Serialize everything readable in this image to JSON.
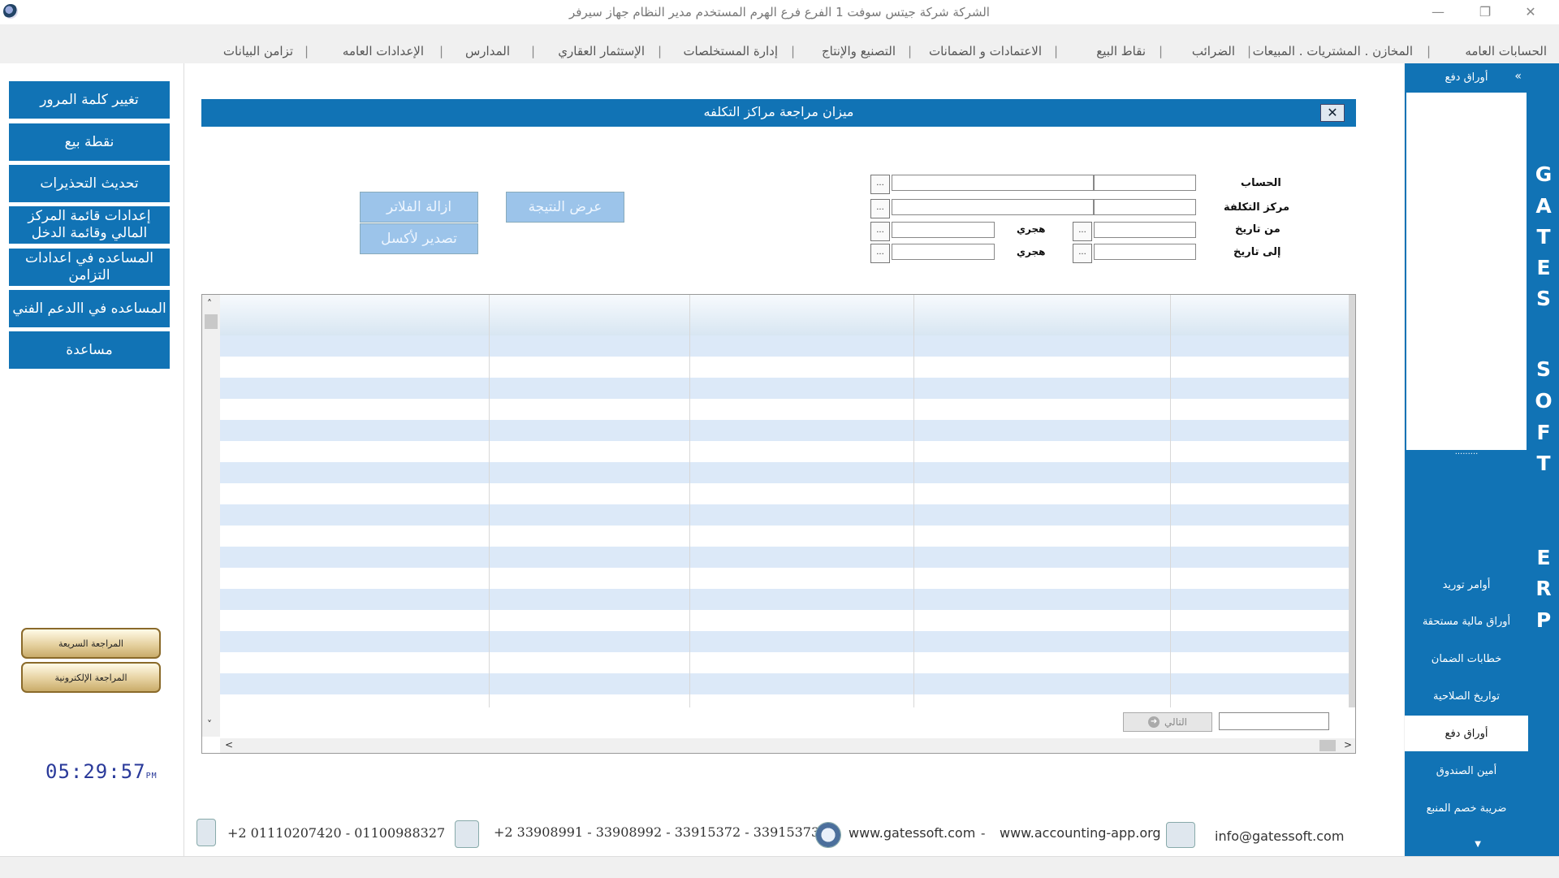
{
  "window": {
    "title": "الشركة شركة جيتس سوفت 1   الفرع فرع الهرم   المستخدم مدير النظام   جهاز سيرفر"
  },
  "menu": [
    "الحسابات العامه",
    "المخازن . المشتريات . المبيعات",
    "الضرائب",
    "نقاط البيع",
    "الاعتمادات و الضمانات",
    "التصنيع والإنتاج",
    "إدارة المستخلصات",
    "الإستثمار العقاري",
    "المدارس",
    "الإعدادات العامه",
    "تزامن البيانات"
  ],
  "left_buttons": [
    "تغيير كلمة المرور",
    "نقطة بيع",
    "تحديث التحذيرات",
    "إعدادات قائمة المركز المالي وقائمة الدخل",
    "المساعده في اعدادات التزامن",
    "المساعده في االدعم الفني",
    "مساعدة"
  ],
  "review_buttons": [
    "المراجعة السريعة",
    "المراجعة الإلكترونية"
  ],
  "clock": {
    "time": "05:29:57",
    "ampm": "PM"
  },
  "dialog": {
    "title": "ميزان مراجعة مراكز التكلفه",
    "close": "✕",
    "fields": {
      "account": "الحساب",
      "cost_center": "مركز التكلفة",
      "from_date": "من تاريخ",
      "to_date": "إلى تاريخ",
      "hijri": "هجري",
      "browse": "..."
    },
    "buttons": {
      "show_result": "عرض النتيجة",
      "clear_filters": "ازالة الفلاتر",
      "export_excel": "تصدير لأكسل"
    },
    "next_label": "التالي"
  },
  "footer": {
    "mobile": "+2 01110207420  - 01100988327",
    "phone": "+2 33908991 - 33908992 -  33915372 - 33915373",
    "web1": "www.gatessoft.com",
    "dash": "-",
    "web2": "www.accounting-app.org",
    "email": "info@gatessoft.com"
  },
  "right_panel": {
    "header": "أوراق دفع",
    "items": [
      "أوامر توريد",
      "أوراق مالية مستحقة",
      "خطابات الضمان",
      "تواريخ الصلاحية",
      "أوراق دفع",
      "أمين الصندوق",
      "ضريبة خصم المنبع"
    ],
    "active_index": 4
  },
  "brand_strip": [
    "G",
    "A",
    "T",
    "E",
    "S",
    "S",
    "O",
    "F",
    "T",
    "E",
    "R",
    "P"
  ],
  "colors": {
    "accent": "#1173b5",
    "row_alt": "#dce9f8",
    "button_disabled": "#9cc4ea"
  }
}
